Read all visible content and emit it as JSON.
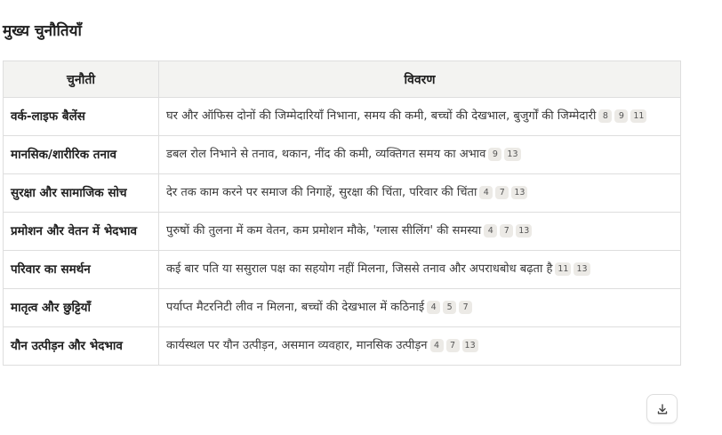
{
  "section": {
    "title": "मुख्य चुनौतियाँ"
  },
  "table": {
    "headers": [
      "चुनौती",
      "विवरण"
    ],
    "rows": [
      {
        "challenge": "वर्क-लाइफ बैलेंस",
        "description": "घर और ऑफिस दोनों की जिम्मेदारियाँ निभाना, समय की कमी, बच्चों की देखभाल, बुजुर्गों की जिम्मेदारी",
        "citations": [
          "8",
          "9",
          "11"
        ]
      },
      {
        "challenge": "मानसिक/शारीरिक तनाव",
        "description": "डबल रोल निभाने से तनाव, थकान, नींद की कमी, व्यक्तिगत समय का अभाव",
        "citations": [
          "9",
          "13"
        ]
      },
      {
        "challenge": "सुरक्षा और सामाजिक सोच",
        "description": "देर तक काम करने पर समाज की निगाहें, सुरक्षा की चिंता, परिवार की चिंता",
        "citations": [
          "4",
          "7",
          "13"
        ]
      },
      {
        "challenge": "प्रमोशन और वेतन में भेदभाव",
        "description": "पुरुषों की तुलना में कम वेतन, कम प्रमोशन मौके, 'ग्लास सीलिंग' की समस्या",
        "citations": [
          "4",
          "7",
          "13"
        ]
      },
      {
        "challenge": "परिवार का समर्थन",
        "description": "कई बार पति या ससुराल पक्ष का सहयोग नहीं मिलना, जिससे तनाव और अपराधबोध बढ़ता है",
        "citations": [
          "11",
          "13"
        ]
      },
      {
        "challenge": "मातृत्व और छुट्टियाँ",
        "description": "पर्याप्त मैटरनिटी लीव न मिलना, बच्चों की देखभाल में कठिनाई",
        "citations": [
          "4",
          "5",
          "7"
        ]
      },
      {
        "challenge": "यौन उत्पीड़न और भेदभाव",
        "description": "कार्यस्थल पर यौन उत्पीड़न, असमान व्यवहार, मानसिक उत्पीड़न",
        "citations": [
          "4",
          "7",
          "13"
        ]
      }
    ]
  },
  "actions": {
    "download_icon": "download-icon"
  }
}
